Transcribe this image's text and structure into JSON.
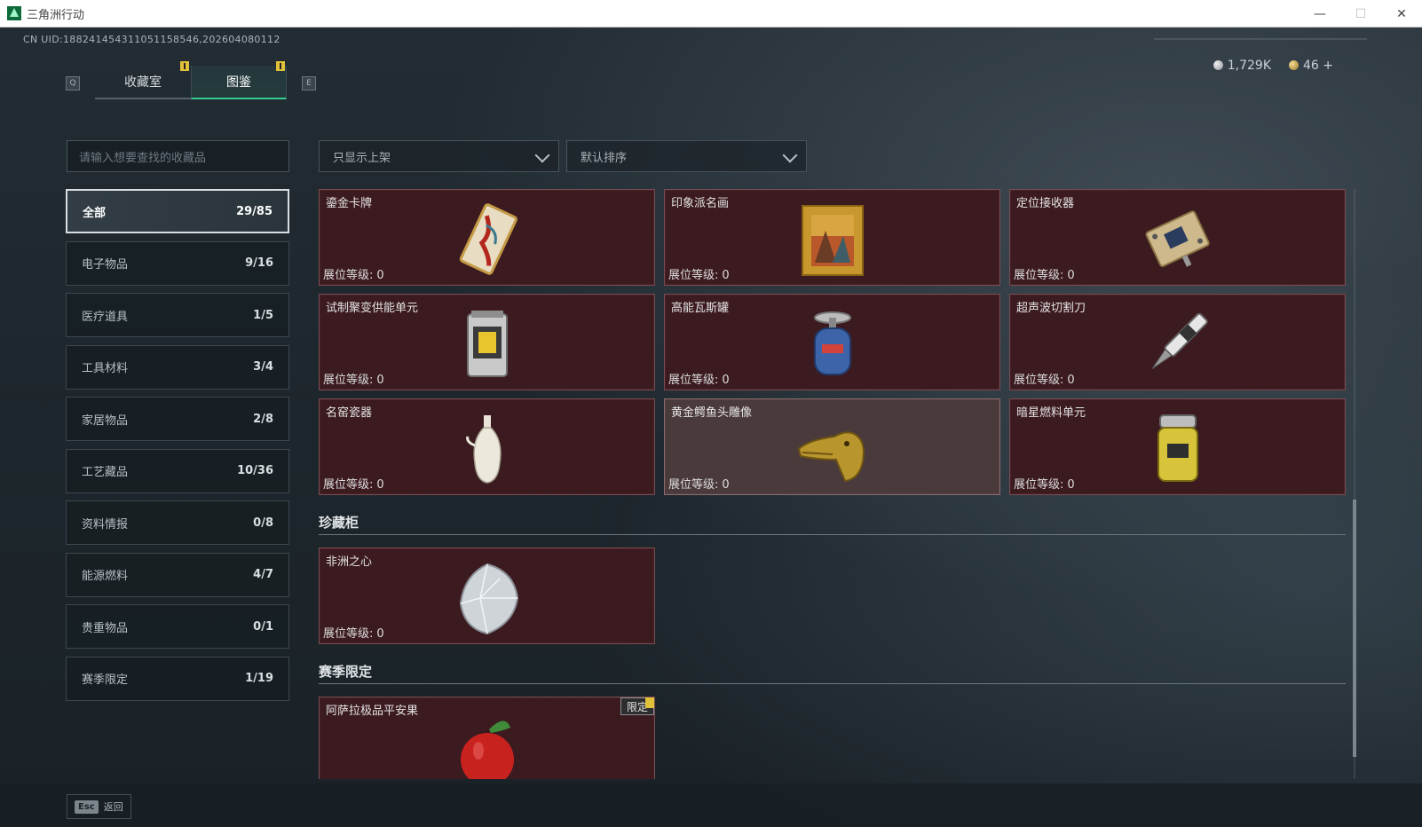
{
  "window": {
    "title": "三角洲行动",
    "minimize": "—",
    "maximize": "☐",
    "close": "✕"
  },
  "header": {
    "uid": "CN UID:1882414543110511585​46,202604080112",
    "currency_silver": "1,729K",
    "currency_gold": "46 +",
    "key_left": "Q",
    "key_right": "E"
  },
  "tabs": [
    {
      "label": "收藏室",
      "active": false
    },
    {
      "label": "图鉴",
      "active": true
    }
  ],
  "search": {
    "placeholder": "请输入想要查找的收藏品"
  },
  "filters": {
    "shelf": "只显示上架",
    "sort": "默认排序"
  },
  "categories": [
    {
      "name": "全部",
      "count": "29/85"
    },
    {
      "name": "电子物品",
      "count": "9/16"
    },
    {
      "name": "医疗道具",
      "count": "1/5"
    },
    {
      "name": "工具材料",
      "count": "3/4"
    },
    {
      "name": "家居物品",
      "count": "2/8"
    },
    {
      "name": "工艺藏品",
      "count": "10/36"
    },
    {
      "name": "资料情报",
      "count": "0/8"
    },
    {
      "name": "能源燃料",
      "count": "4/7"
    },
    {
      "name": "贵重物品",
      "count": "0/1"
    },
    {
      "name": "赛季限定",
      "count": "1/19"
    }
  ],
  "level_label": "展位等级:",
  "items": [
    {
      "name": "鎏金卡牌",
      "level": "0",
      "icon": "gilded-card-icon"
    },
    {
      "name": "印象派名画",
      "level": "0",
      "icon": "framed-painting-icon"
    },
    {
      "name": "定位接收器",
      "level": "0",
      "icon": "locator-receiver-icon"
    },
    {
      "name": "试制聚变供能单元",
      "level": "0",
      "icon": "fusion-unit-icon"
    },
    {
      "name": "高能瓦斯罐",
      "level": "0",
      "icon": "gas-canister-icon"
    },
    {
      "name": "超声波切割刀",
      "level": "0",
      "icon": "ultrasonic-cutter-icon"
    },
    {
      "name": "名窑瓷器",
      "level": "0",
      "icon": "porcelain-vase-icon"
    },
    {
      "name": "黄金鳄鱼头雕像",
      "level": "0",
      "icon": "gold-crocodile-head-icon"
    },
    {
      "name": "暗星燃料单元",
      "level": "0",
      "icon": "dark-star-fuel-icon"
    }
  ],
  "sections": [
    {
      "title": "珍藏柜",
      "items": [
        {
          "name": "非洲之心",
          "level": "0",
          "icon": "diamond-icon"
        }
      ]
    },
    {
      "title": "赛季限定",
      "items": [
        {
          "name": "阿萨拉极品平安果",
          "tag": "限定",
          "icon": "apple-icon"
        }
      ]
    }
  ],
  "footer": {
    "esc_key": "Esc",
    "back_label": "返回"
  }
}
